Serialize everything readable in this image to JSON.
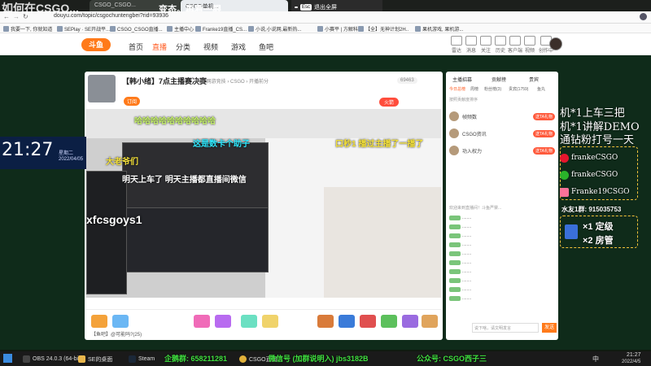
{
  "overlay": {
    "top_left_text": "如何在CSGO...",
    "top_center_text": "变态。再看一眼",
    "clock_time": "21:27",
    "clock_weekday": "星期二",
    "clock_date": "2022/04/05",
    "streamer_id": "xfcsgoys1",
    "right_marquee": [
      "机*1上车三把",
      "机*1讲解DEMO",
      "通钻粉打号一天"
    ],
    "social": [
      {
        "icon": "weibo-icon",
        "name": "frankeCSGO"
      },
      {
        "icon": "wechat-icon",
        "name": "frankeCSGO"
      },
      {
        "icon": "bilibili-icon",
        "name": "Franke19CSGO"
      }
    ],
    "fan_group": "水友1群: 915035753",
    "badge_lines": [
      "×1 定级",
      "×2 房管"
    ]
  },
  "browser": {
    "tabs": [
      "CSGO_CSGO...",
      "CSGO单机..."
    ],
    "url": "douyu.com/topic/csgochuntengbei?rid=93936",
    "fullscreen_tip": "退出全屏",
    "esc_key": "Esc",
    "bookmarks": [
      "我要一下, 你就知道",
      "SEPlay · SE开战平...",
      "CSGO_CSGO直播...",
      "主播中心",
      "Franke19直播_CS...",
      "小说,小说网,最新热...",
      "小赛平 | 方解科..",
      "【全】无神计划2H..",
      "果机游戏, 果机游..."
    ]
  },
  "site": {
    "nav": [
      "首页",
      "直播",
      "分类",
      "视频",
      "游戏",
      "鱼吧"
    ],
    "header_icons": [
      {
        "icon": "radar-icon",
        "label": "雷达"
      },
      {
        "icon": "notification-icon",
        "label": "消息"
      },
      {
        "icon": "follow-icon",
        "label": "关注"
      },
      {
        "icon": "history-icon",
        "label": "历史"
      },
      {
        "icon": "ticket-icon",
        "label": "客户端"
      },
      {
        "icon": "video-icon",
        "label": "视频"
      },
      {
        "icon": "creator-icon",
        "label": "创作中心"
      }
    ]
  },
  "stream": {
    "title": "【韩小绪】7点主播赛决赛",
    "meta": "举报  网游竞技 › CSGO › 开播前分",
    "follow_count": "69463",
    "subscribe_label": "订阅",
    "fan_badge": "火箭",
    "overlay_texts": {
      "laugh": "哈哈哈哈哈哈哈哈哈哈",
      "top_banner": "这是数卡个助子",
      "stream_share": "明天上车了 明天主播都直播间微信",
      "boss": "大老爷们",
      "handle": "口秒1  播过主播了一播了"
    },
    "toolbar_left": "【鱼吧】@可能吗?(25)",
    "toolbar_btn": "发送"
  },
  "sidebar": {
    "tabs": [
      "主播招募",
      "贡献榜",
      "贵宾"
    ],
    "tab_sub": [
      "今日总榜",
      "周榜",
      "粉丝榜(3)",
      "贵宾(1759)",
      "鱼丸"
    ],
    "subtitle": "按照贡献度排序",
    "rank": [
      {
        "name": "帧频数",
        "btn": "送TA礼物"
      },
      {
        "name": "CSGO资讯",
        "btn": "送TA礼物"
      },
      {
        "name": "功入权力",
        "btn": "送TA礼物"
      }
    ],
    "chat_notice": "欢迎来到直播间！斗鱼严禁...",
    "chat_input": "说下啥，请文明发言",
    "send_label": "发送"
  },
  "taskbar": {
    "tasks": [
      "OBS 24.0.3 (64-bit...",
      "SE的桌面",
      "Steam",
      "CSGO直播..."
    ],
    "banner": [
      "企鹅群: 658211281",
      "微信号 (加群说明入) jbs3182B",
      "公众号: CSGO西子三"
    ],
    "tray_time": "21:27",
    "tray_date": "2022/4/5",
    "lang": "中"
  }
}
